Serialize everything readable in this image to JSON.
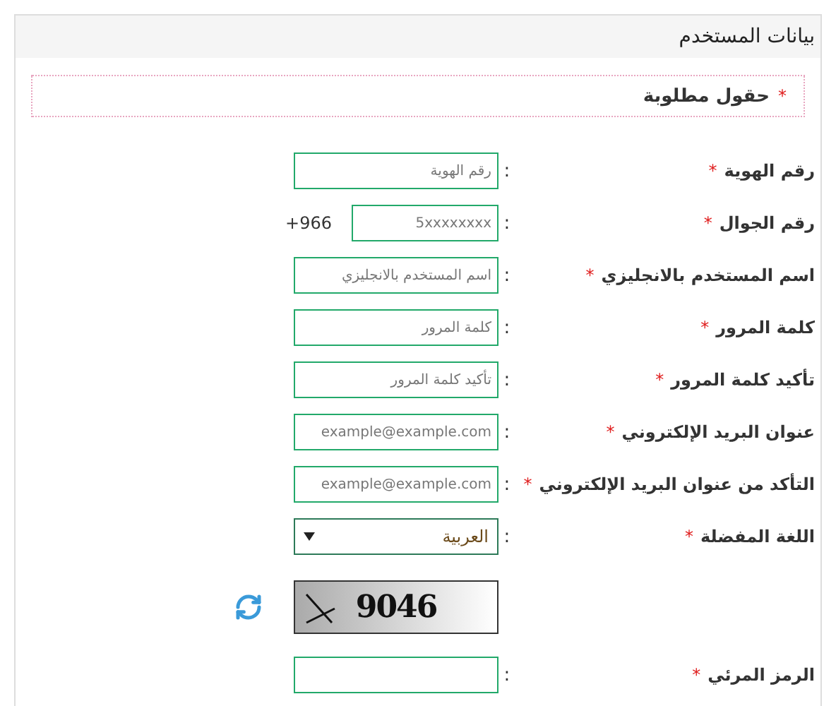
{
  "panel": {
    "title": "بيانات المستخدم"
  },
  "required_note": {
    "mark": "*",
    "text": "حقول مطلوبة"
  },
  "required_mark": "*",
  "separator": ":",
  "fields": [
    {
      "kind": "text",
      "label": "رقم الهوية",
      "required": true,
      "placeholder": "رقم الهوية"
    },
    {
      "kind": "phone",
      "label": "رقم الجوال",
      "required": true,
      "placeholder": "5xxxxxxxx",
      "prefix": "+966"
    },
    {
      "kind": "text",
      "label": "اسم المستخدم بالانجليزي",
      "required": true,
      "placeholder": "اسم المستخدم بالانجليزي"
    },
    {
      "kind": "text",
      "label": "كلمة المرور",
      "required": true,
      "placeholder": "كلمة المرور"
    },
    {
      "kind": "text",
      "label": "تأكيد كلمة المرور",
      "required": true,
      "placeholder": "تأكيد كلمة المرور"
    },
    {
      "kind": "text",
      "label": "عنوان البريد الإلكتروني",
      "required": true,
      "placeholder": "example@example.com"
    },
    {
      "kind": "text",
      "label": "التأكد من عنوان البريد الإلكتروني",
      "required": true,
      "placeholder": "example@example.com"
    },
    {
      "kind": "select",
      "label": "اللغة المفضلة",
      "required": true,
      "value": "العربية"
    },
    {
      "kind": "captcha",
      "code": "9046"
    },
    {
      "kind": "text",
      "label": "الرمز المرئي",
      "required": true
    }
  ]
}
